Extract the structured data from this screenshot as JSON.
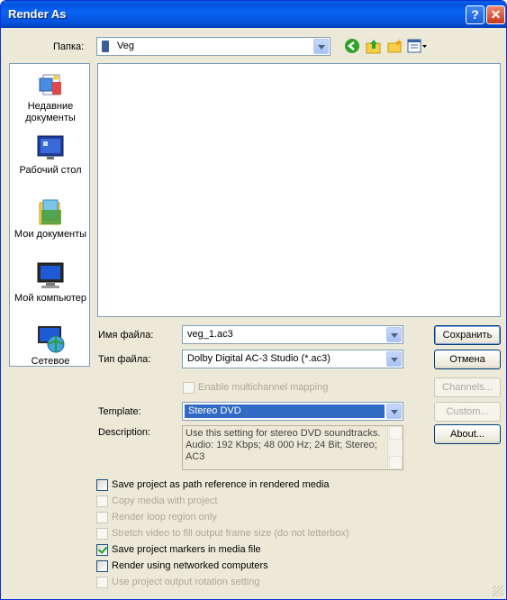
{
  "window": {
    "title": "Render As",
    "help_glyph": "?",
    "close_glyph": "✕"
  },
  "lookin": {
    "label": "Папка:",
    "value": "Veg"
  },
  "places": [
    {
      "label": "Недавние документы",
      "icon": "recent-documents-icon"
    },
    {
      "label": "Рабочий стол",
      "icon": "desktop-icon"
    },
    {
      "label": "Мои документы",
      "icon": "my-documents-icon"
    },
    {
      "label": "Мой компьютер",
      "icon": "my-computer-icon"
    },
    {
      "label": "Сетевое",
      "icon": "network-icon"
    }
  ],
  "filename": {
    "label": "Имя файла:",
    "value": "veg_1.ac3"
  },
  "filetype": {
    "label": "Тип файла:",
    "value": "Dolby Digital AC-3 Studio (*.ac3)"
  },
  "buttons": {
    "save": "Сохранить",
    "cancel": "Отмена",
    "channels": "Channels...",
    "custom": "Custom...",
    "about": "About..."
  },
  "multichannel": {
    "label": "Enable multichannel mapping",
    "checked": false
  },
  "template": {
    "label": "Template:",
    "value": "Stereo DVD"
  },
  "description": {
    "label": "Description:",
    "text": "Use this setting for stereo DVD soundtracks. Audio: 192 Kbps; 48 000 Hz; 24 Bit; Stereo; AC3"
  },
  "options": [
    {
      "label": "Save project as path reference in rendered media",
      "checked": false,
      "enabled": true
    },
    {
      "label": "Copy media with project",
      "checked": false,
      "enabled": false
    },
    {
      "label": "Render loop region only",
      "checked": false,
      "enabled": false
    },
    {
      "label": "Stretch video to fill output frame size (do not letterbox)",
      "checked": false,
      "enabled": false
    },
    {
      "label": "Save project markers in media file",
      "checked": true,
      "enabled": true
    },
    {
      "label": "Render using networked computers",
      "checked": false,
      "enabled": true
    },
    {
      "label": "Use project output rotation setting",
      "checked": false,
      "enabled": false
    }
  ]
}
